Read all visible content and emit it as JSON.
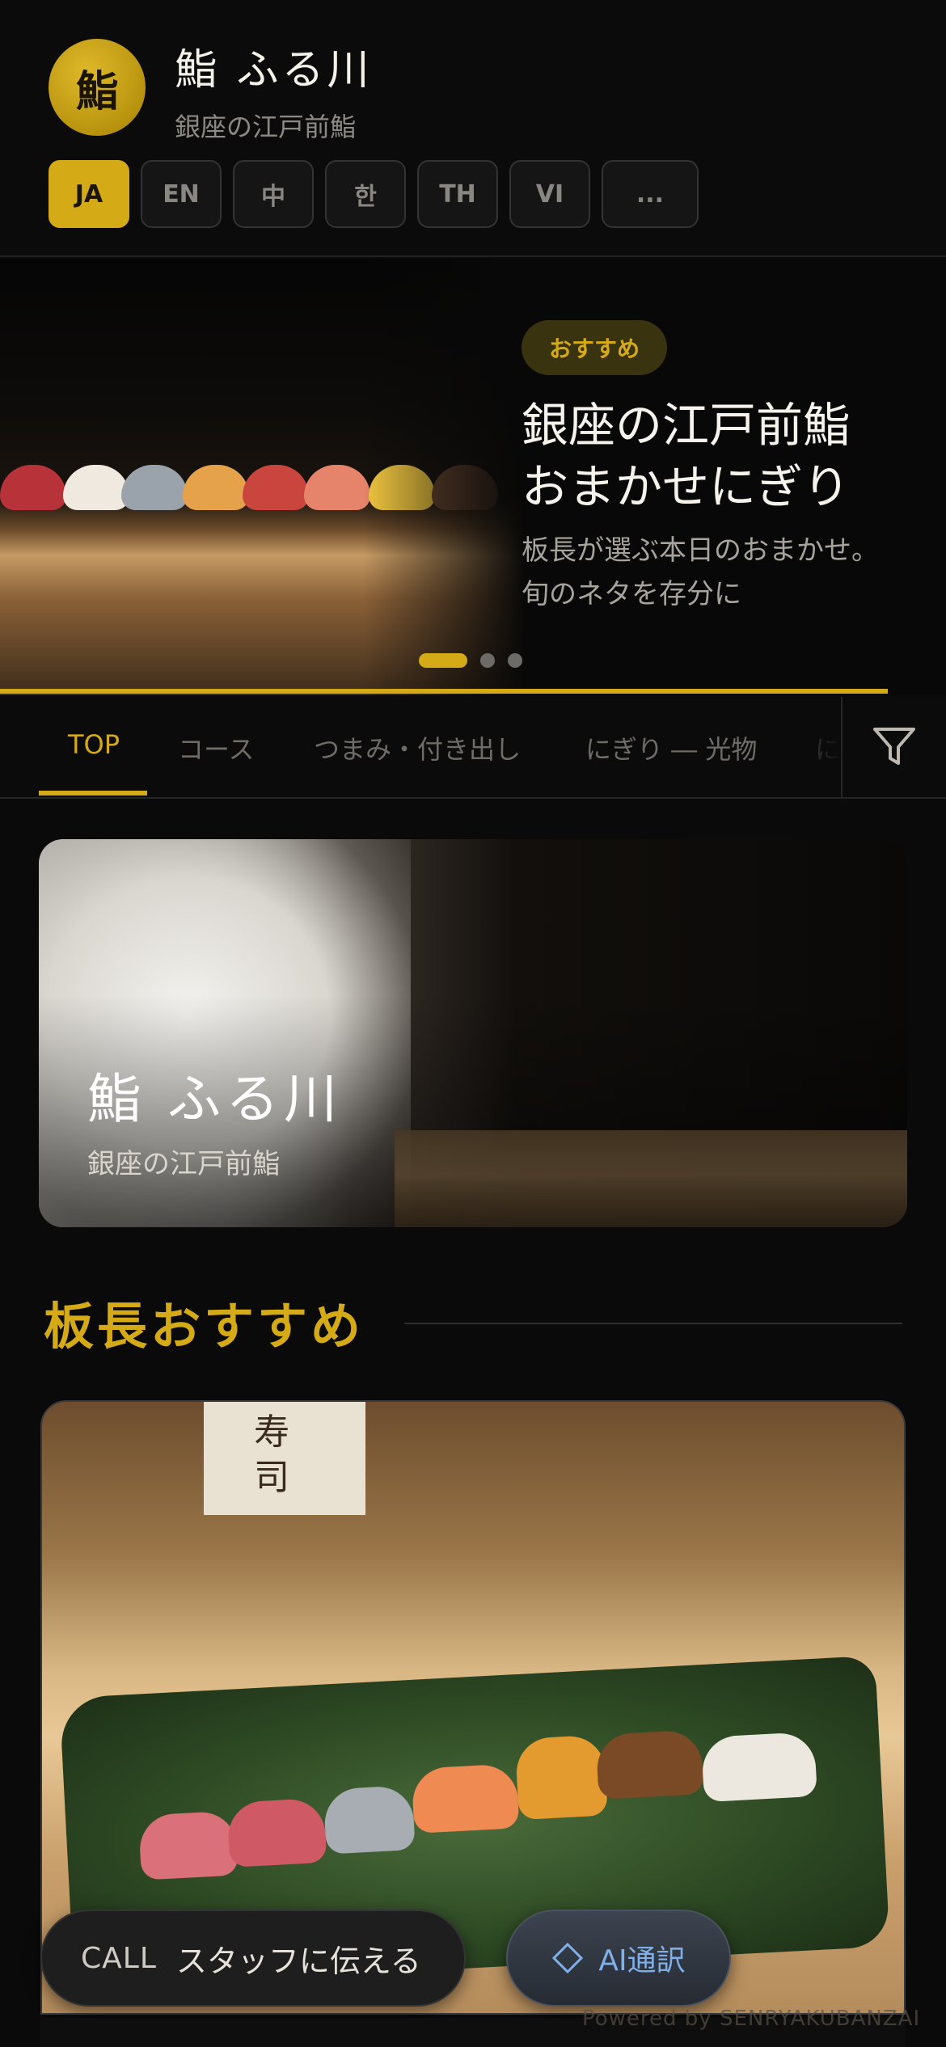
{
  "header": {
    "logo_char": "鮨",
    "name": "鮨 ふる川",
    "subtitle": "銀座の江戸前鮨"
  },
  "languages": [
    {
      "label": "JA",
      "active": true
    },
    {
      "label": "EN",
      "active": false
    },
    {
      "label": "中",
      "active": false
    },
    {
      "label": "한",
      "active": false
    },
    {
      "label": "TH",
      "active": false
    },
    {
      "label": "VI",
      "active": false
    },
    {
      "label": "...",
      "active": false
    }
  ],
  "hero": {
    "badge": "おすすめ",
    "title": "銀座の江戸前鮨\nおまかせにぎり",
    "description": "板長が選ぶ本日のおまかせ。旬のネタを存分に",
    "slide_count": 3,
    "active_slide": 1
  },
  "tabs": [
    {
      "label": "TOP",
      "active": true
    },
    {
      "label": "コース",
      "active": false
    },
    {
      "label": "つまみ・付き出し",
      "active": false
    },
    {
      "label": "にぎり ― 光物",
      "active": false
    },
    {
      "label": "に",
      "active": false
    }
  ],
  "banner": {
    "title": "鮨 ふる川",
    "subtitle": "銀座の江戸前鮨"
  },
  "section": {
    "title": "板長おすすめ"
  },
  "card": {
    "noren_text": "寿司"
  },
  "actions": {
    "call_label": "CALL",
    "call_text": "スタッフに伝える",
    "ai_text": "AI通訳"
  },
  "footer": {
    "powered": "Powered by SENRYAKUBANZAI"
  },
  "colors": {
    "accent": "#d4aa16",
    "background": "#0a0a0a",
    "ai_blue": "#7fb0ea"
  }
}
